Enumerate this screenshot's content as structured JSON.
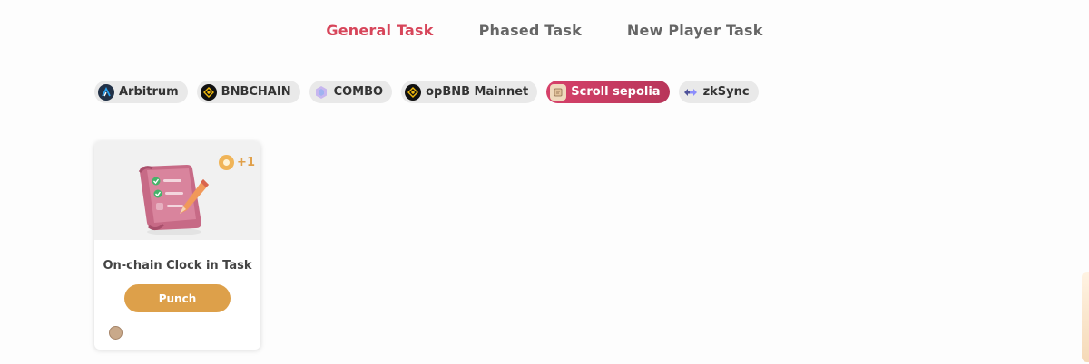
{
  "tabs": [
    {
      "label": "General Task",
      "active": true
    },
    {
      "label": "Phased Task",
      "active": false
    },
    {
      "label": "New Player Task",
      "active": false
    }
  ],
  "chains": [
    {
      "label": "Arbitrum",
      "icon": "arbitrum-icon"
    },
    {
      "label": "BNBCHAIN",
      "icon": "bnb-icon"
    },
    {
      "label": "COMBO",
      "icon": "combo-icon"
    },
    {
      "label": "opBNB Mainnet",
      "icon": "opbnb-icon"
    },
    {
      "label": "Scroll sepolia",
      "icon": "scroll-icon",
      "active": true
    },
    {
      "label": "zkSync",
      "icon": "zksync-icon"
    }
  ],
  "task_card": {
    "title": "On-chain Clock in Task",
    "reward": "+1",
    "button_label": "Punch",
    "illustration": "scroll-checklist-icon",
    "chain_icon": "scroll-icon"
  },
  "colors": {
    "accent": "#d7455a",
    "button": "#dda04a",
    "chip_active": "#c93c62"
  }
}
